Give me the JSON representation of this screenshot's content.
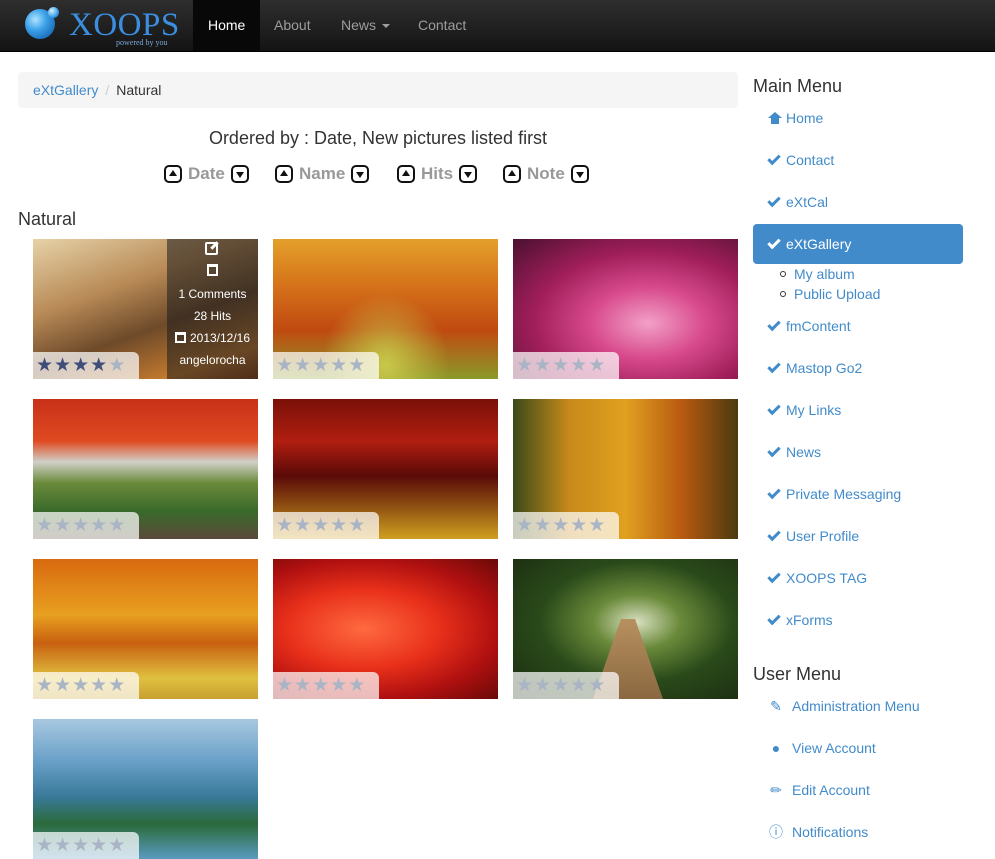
{
  "navbar": {
    "brand": "XOOPS",
    "tagline": "powered by you",
    "items": [
      {
        "label": "Home"
      },
      {
        "label": "About"
      },
      {
        "label": "News"
      },
      {
        "label": "Contact"
      }
    ]
  },
  "breadcrumb": {
    "parent": "eXtGallery",
    "separator": "/",
    "current": "Natural"
  },
  "ordering": {
    "text": "Ordered by : Date, New pictures listed first",
    "sorts": [
      {
        "label": "Date"
      },
      {
        "label": "Name"
      },
      {
        "label": "Hits"
      },
      {
        "label": "Note"
      }
    ]
  },
  "album_title": "Natural",
  "photos": [
    {
      "rating": 4,
      "theme": "misty-forest",
      "info": {
        "comments": "1 Comments",
        "hits": "28 Hits",
        "date": "2013/12/16",
        "author": "angelorocha"
      }
    },
    {
      "rating": 0,
      "theme": "orange-trees"
    },
    {
      "rating": 0,
      "theme": "pink-tunnel"
    },
    {
      "rating": 0,
      "theme": "japanese-garden"
    },
    {
      "rating": 0,
      "theme": "red-forest-bench"
    },
    {
      "rating": 0,
      "theme": "golden-forest"
    },
    {
      "rating": 0,
      "theme": "yellow-orange-park"
    },
    {
      "rating": 0,
      "theme": "red-maple"
    },
    {
      "rating": 0,
      "theme": "wooden-bridge"
    },
    {
      "rating": 0,
      "theme": "fantasy-mountains"
    }
  ],
  "main_menu": {
    "title": "Main Menu",
    "items": [
      {
        "label": "Home",
        "icon": "home-icon"
      },
      {
        "label": "Contact",
        "icon": "check-icon"
      },
      {
        "label": "eXtCal",
        "icon": "check-icon"
      },
      {
        "label": "eXtGallery",
        "icon": "check-icon",
        "active": true
      },
      {
        "label": "fmContent",
        "icon": "check-icon"
      },
      {
        "label": "Mastop Go2",
        "icon": "check-icon"
      },
      {
        "label": "My Links",
        "icon": "check-icon"
      },
      {
        "label": "News",
        "icon": "check-icon"
      },
      {
        "label": "Private Messaging",
        "icon": "check-icon"
      },
      {
        "label": "User Profile",
        "icon": "check-icon"
      },
      {
        "label": "XOOPS TAG",
        "icon": "check-icon"
      },
      {
        "label": "xForms",
        "icon": "check-icon"
      }
    ],
    "sub_items": [
      {
        "label": "My album"
      },
      {
        "label": "Public Upload"
      }
    ]
  },
  "user_menu": {
    "title": "User Menu",
    "items": [
      {
        "label": "Administration Menu",
        "icon": "wrench-icon"
      },
      {
        "label": "View Account",
        "icon": "user-icon"
      },
      {
        "label": "Edit Account",
        "icon": "pencil-icon"
      },
      {
        "label": "Notifications",
        "icon": "info-icon"
      }
    ]
  },
  "colors": {
    "link": "#428bca",
    "navbar": "#222222",
    "active_menu": "#428bca"
  }
}
